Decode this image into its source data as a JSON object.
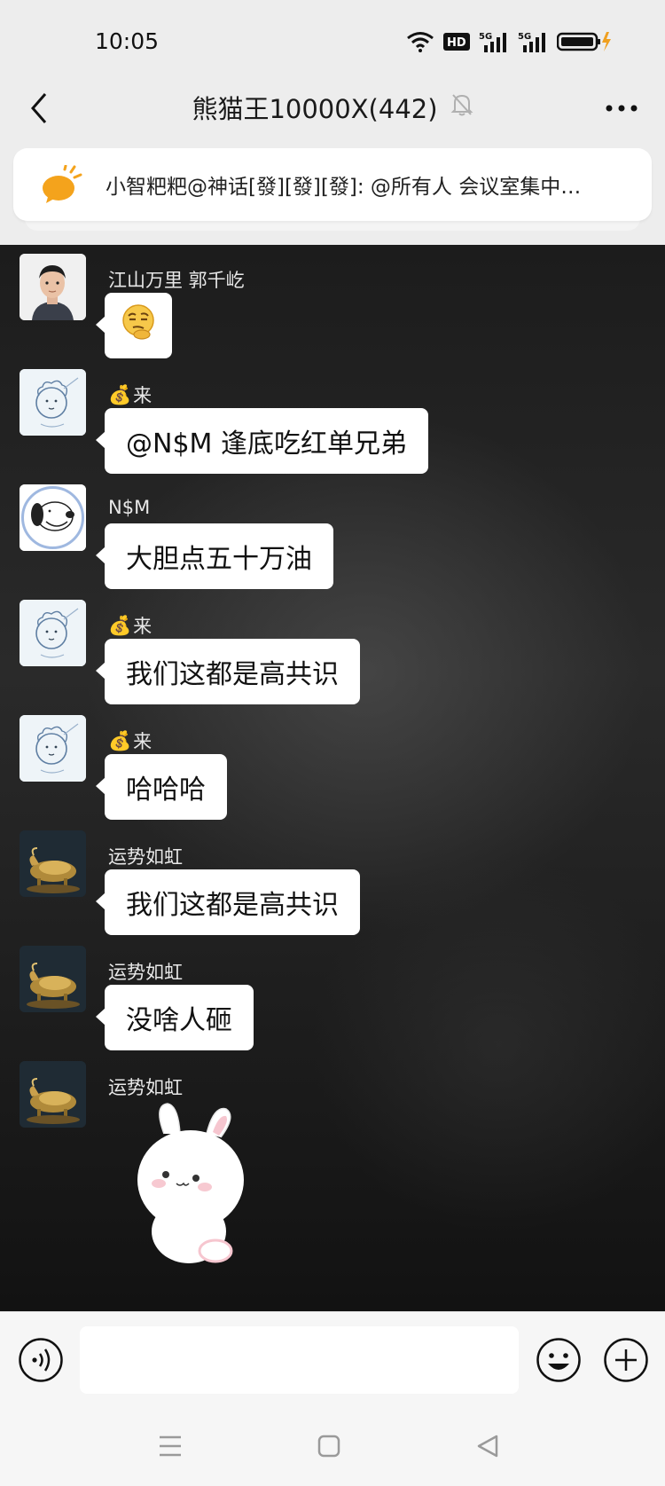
{
  "status_bar": {
    "time": "10:05",
    "network_a": "5G",
    "network_b": "5G",
    "hd_label": "HD"
  },
  "header": {
    "title": "熊猫王10000X(442)"
  },
  "announcement": {
    "text": "小智粑粑@神话[發][發][發]: @所有人 会议室集中…"
  },
  "messages": [
    {
      "sender": "江山万里 郭千屹",
      "avatar": "man-photo",
      "content": "",
      "type": "emoji"
    },
    {
      "sender_icon": "💰",
      "sender": "来",
      "avatar": "lion-sketch",
      "content": "@N$M  逢底吃红单兄弟",
      "type": "text"
    },
    {
      "sender": "N$M",
      "avatar": "snoopy",
      "content": "大胆点五十万油",
      "type": "text"
    },
    {
      "sender_icon": "💰",
      "sender": "来",
      "avatar": "lion-sketch",
      "content": "我们这都是高共识",
      "type": "text"
    },
    {
      "sender_icon": "💰",
      "sender": "来",
      "avatar": "lion-sketch",
      "content": "哈哈哈",
      "type": "text"
    },
    {
      "sender": "运势如虹",
      "avatar": "golden-bull",
      "content": "我们这都是高共识",
      "type": "text"
    },
    {
      "sender": "运势如虹",
      "avatar": "golden-bull",
      "content": "没啥人砸",
      "type": "text"
    },
    {
      "sender": "运势如虹",
      "avatar": "golden-bull",
      "content": "",
      "type": "sticker",
      "sticker": "bunny-sticker"
    }
  ],
  "input": {
    "placeholder": "",
    "value": ""
  },
  "icons": {
    "back": "back-arrow-icon",
    "mute": "bell-off-icon",
    "more": "more-icon",
    "announce": "megaphone-icon",
    "voice": "voice-icon",
    "emoji": "emoji-icon",
    "plus": "plus-icon"
  },
  "colors": {
    "accent": "#f0a020",
    "chat_bg": "#1e1e1e",
    "bubble": "#ffffff"
  }
}
